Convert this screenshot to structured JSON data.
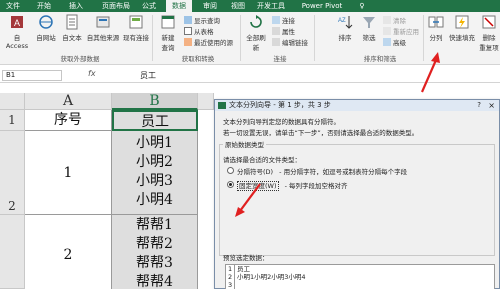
{
  "ribbon_tabs": [
    {
      "label": "文件",
      "active": false
    },
    {
      "label": "开始",
      "active": false
    },
    {
      "label": "插入",
      "active": false
    },
    {
      "label": "页面布局",
      "active": false
    },
    {
      "label": "公式",
      "active": false
    },
    {
      "label": "数据",
      "active": true
    },
    {
      "label": "审阅",
      "active": false
    },
    {
      "label": "视图",
      "active": false
    },
    {
      "label": "开发工具",
      "active": false
    },
    {
      "label": "Power Pivot",
      "active": false
    },
    {
      "label": "♀",
      "active": false
    }
  ],
  "ribbon": {
    "get_external": {
      "access": "自 Access",
      "web": "自网站",
      "text": "自文本",
      "other": "自其他来源",
      "existing": "现有连接",
      "label": "获取外部数据"
    },
    "get_transform": {
      "new_query": "新建",
      "new_query2": "查询",
      "show_queries": "显示查询",
      "from_table": "从表格",
      "recent_sources": "最近使用的源",
      "label": "获取和转换"
    },
    "connections": {
      "refresh_all": "全部刷新",
      "connections": "连接",
      "properties": "属性",
      "edit_links": "编辑链接",
      "label": "连接"
    },
    "sort_filter": {
      "sort": "排序",
      "filter": "筛选",
      "clear": "清除",
      "reapply": "重新应用",
      "advanced": "高级",
      "label": "排序和筛选"
    },
    "data_tools": {
      "text_to_columns": "分列",
      "flash_fill": "快速填充",
      "remove_dup": "删除",
      "remove_dup2": "重复项"
    }
  },
  "formula_bar": {
    "name_box": "B1",
    "fx": "fx",
    "value": "员工"
  },
  "sheet": {
    "columns": [
      "A",
      "B"
    ],
    "rows": [
      "1",
      "2"
    ],
    "header_row": [
      "序号",
      "员工"
    ],
    "groups": [
      {
        "index": "1",
        "names": [
          "小明1",
          "小明2",
          "小明3",
          "小明4"
        ]
      },
      {
        "index": "2",
        "names": [
          "帮帮1",
          "帮帮2",
          "帮帮3",
          "帮帮4"
        ]
      }
    ]
  },
  "dialog": {
    "title": "文本分列向导 - 第 1 步，共 3 步",
    "help": "?",
    "close": "×",
    "line1": "文本分列向导判定您的数据具有分隔符。",
    "line2": "若一切设置无误，请单击“下一步”，否则请选择最合适的数据类型。",
    "frame_title": "原始数据类型",
    "choose_label": "请选择最合适的文件类型：",
    "option1_label": "分隔符号(D)",
    "option1_desc": "- 用分隔字符，如逗号或制表符分隔每个字段",
    "option2_label": "固定宽度(W)",
    "option2_desc": "- 每列字段加空格对齐",
    "preview_label": "预览选定数据：",
    "preview_rows": [
      {
        "num": "1",
        "text": "员工"
      },
      {
        "num": "2",
        "text": "小明1小明2小明3小明4"
      },
      {
        "num": "3",
        "text": ""
      }
    ]
  },
  "colors": {
    "brand": "#217346",
    "annotation": "#e02020"
  }
}
